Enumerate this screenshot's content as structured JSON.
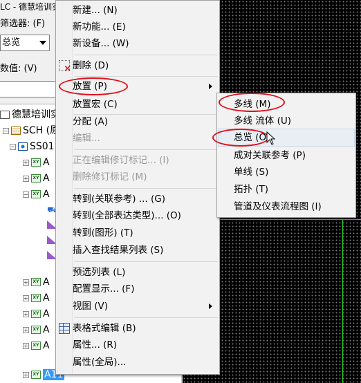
{
  "app": {
    "window_title": "LC - 德慧培训实",
    "filter_label": "筛选器: (F)",
    "filter_value": "总览",
    "value_label": "数值: (V)"
  },
  "tree": {
    "items": [
      {
        "label": "德慧培训实"
      },
      {
        "label": "SCH (原"
      },
      {
        "label": "SS01"
      },
      {
        "label": "A"
      },
      {
        "label": "A"
      },
      {
        "label": "A"
      },
      {
        "label": "A"
      },
      {
        "label": "A"
      },
      {
        "label": "A"
      },
      {
        "label": "A"
      },
      {
        "label": "A"
      },
      {
        "label": "A11"
      }
    ]
  },
  "context_menu": {
    "new": "新建... (N)",
    "new_function": "新功能... (E)",
    "new_equipment": "新设备... (W)",
    "delete": "删除 (D)",
    "place": "放置 (P)",
    "place_macro": "放置宏 (C)",
    "assign": "分配 (A)",
    "edit": "编辑...",
    "editing_revision": "正在编辑修订标记... (I)",
    "delete_revision": "删除修订标记 (M)",
    "goto_ref": "转到(关联参考) ... (G)",
    "goto_all": "转到(全部表达类型)... (O)",
    "goto_graphic": "转到(图形) (T)",
    "insert_results": "插入查找结果列表 (S)",
    "preselect_list": "预选列表 (L)",
    "config_display": "配置显示... (F)",
    "view": "视图 (V)",
    "table_edit": "表格式编辑 (B)",
    "properties": "属性... (R)",
    "properties_global": "属性(全局)..."
  },
  "sub_menu": {
    "multiline": "多线 (M)",
    "multiline_fluid": "多线 流体 (U)",
    "overview": "总览 (O)",
    "paired_ref": "成对关联参考 (P)",
    "single_line": "单线 (S)",
    "topology": "拓扑 (T)",
    "piping": "管道及仪表流程图 (I)"
  },
  "colors": {
    "annotation": "#e0101a",
    "canvas_bg": "#000000",
    "canvas_line": "#2ad02a",
    "selection": "#3399ff"
  }
}
